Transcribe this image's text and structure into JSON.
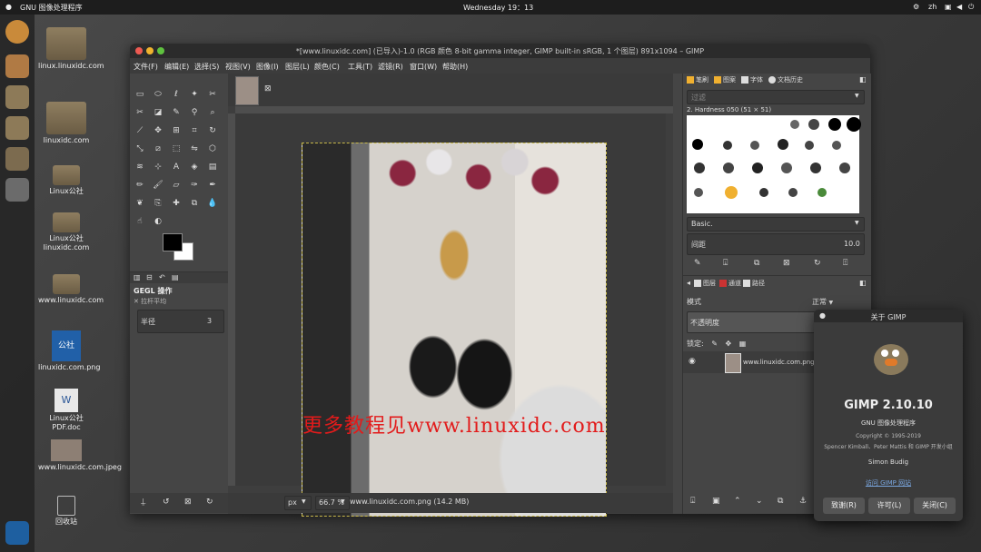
{
  "topbar": {
    "app_name": "GNU 图像处理程序",
    "clock": "Wednesday 19：13",
    "lang": "zh"
  },
  "desktop_icons": [
    {
      "label": "linux.linuxidc.com",
      "kind": "folder"
    },
    {
      "label": "linuxidc.com",
      "kind": "folder"
    },
    {
      "label": "Linux公社",
      "kind": "folder"
    },
    {
      "label": "Linux公社linuxidc.com",
      "kind": "folder"
    },
    {
      "label": "www.linuxidc.com",
      "kind": "folder"
    },
    {
      "label": "linuxidc.com.png",
      "kind": "image"
    },
    {
      "label": "Linux公社PDF.doc",
      "kind": "doc"
    },
    {
      "label": "www.linuxidc.com.jpeg",
      "kind": "image"
    },
    {
      "label": "回收站",
      "kind": "trash"
    }
  ],
  "window": {
    "title": "*[www.linuxidc.com] (已导入)-1.0 (RGB 颜色 8-bit gamma integer, GIMP built-in sRGB, 1 个图层) 891x1094 – GIMP",
    "menus": [
      "文件(F)",
      "编辑(E)",
      "选择(S)",
      "视图(V)",
      "图像(I)",
      "图层(L)",
      "颜色(C)",
      "工具(T)",
      "滤镜(R)",
      "窗口(W)",
      "帮助(H)"
    ]
  },
  "toolbox": {
    "gegl_title": "GEGL 操作",
    "gegl_subtitle": "拉杆平均",
    "radius_label": "半径",
    "radius_value": "3"
  },
  "canvas": {
    "overlay_text": "更多教程见www.linuxidc.com",
    "unit": "px",
    "zoom": "66.7 %",
    "status": "www.linuxidc.com.png (14.2 MB)"
  },
  "right_dock": {
    "tabs": [
      "笔刷",
      "图案",
      "字体",
      "文档历史"
    ],
    "filter_placeholder": "过滤",
    "brush_name": "2. Hardness 050 (51 × 51)",
    "preset": "Basic.",
    "spacing_label": "间距",
    "spacing_value": "10.0",
    "layer_tabs": [
      "图层",
      "通道",
      "路径"
    ],
    "mode_label": "模式",
    "mode_value": "正常",
    "opacity_label": "不透明度",
    "lock_label": "锁定:",
    "layer_name": "www.linuxidc.com.png"
  },
  "about": {
    "title": "关于 GIMP",
    "version": "GIMP 2.10.10",
    "subtitle": "GNU 图像处理程序",
    "copyright": "Copyright © 1995-2019",
    "authors": "Spencer Kimball、Peter Mattis 和 GIMP 开发小组",
    "credit": "Simon Budig",
    "link": "访问 GIMP 网站",
    "buttons": [
      "致谢(R)",
      "许可(L)",
      "关闭(C)"
    ]
  },
  "colors": {
    "accent": "#f0b030",
    "overlay_text": "#e21b1b"
  }
}
